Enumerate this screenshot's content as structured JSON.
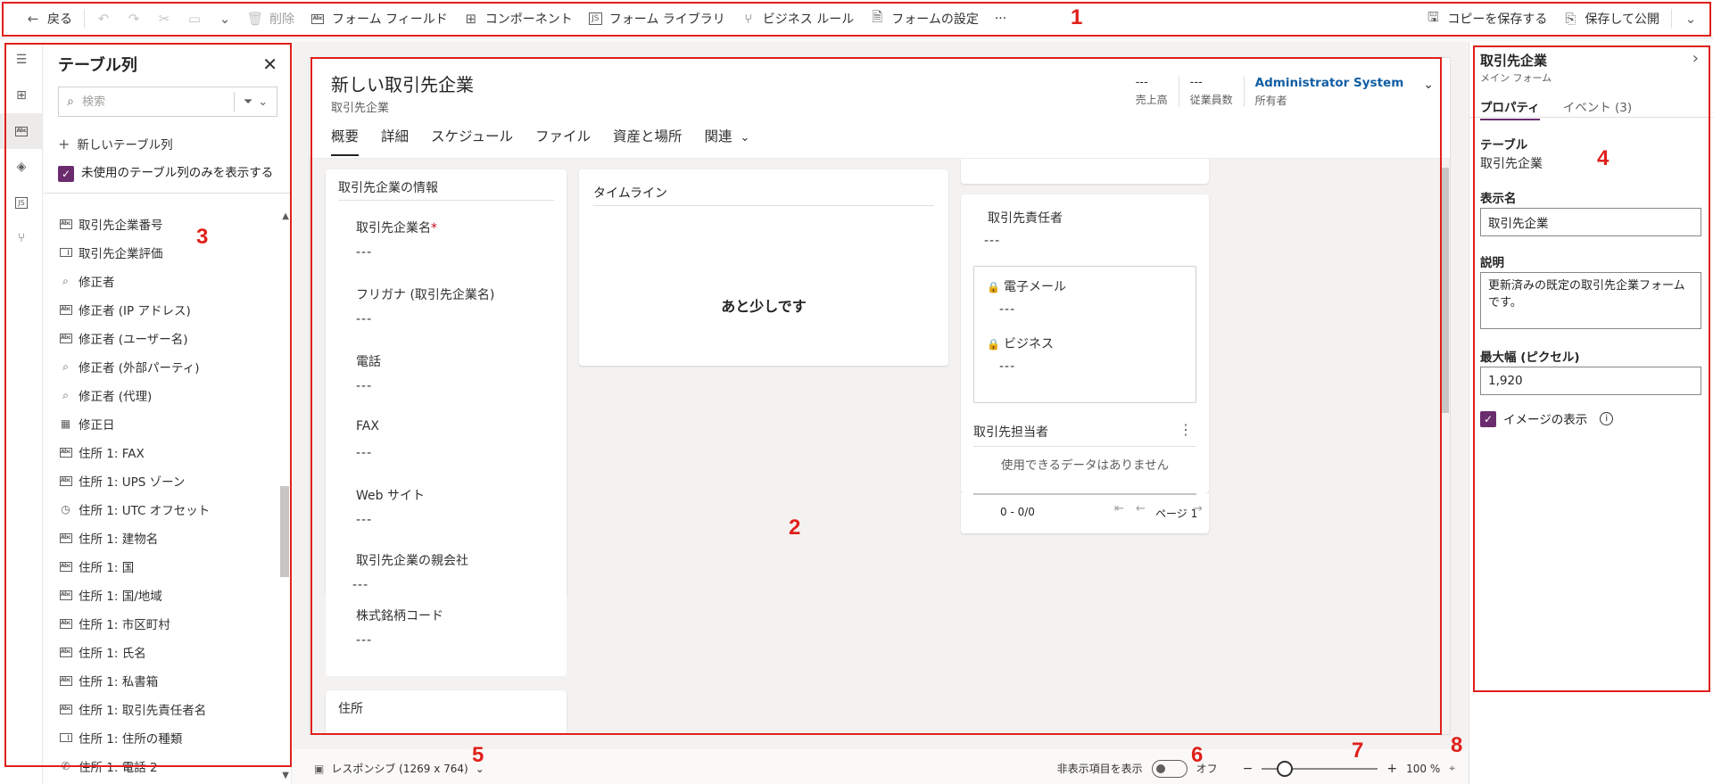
{
  "toolbar": {
    "back": "戻る",
    "delete": "削除",
    "form_field": "フォーム フィールド",
    "component": "コンポーネント",
    "form_library": "フォーム ライブラリ",
    "business_rule": "ビジネス ルール",
    "form_settings": "フォームの設定",
    "more": "···",
    "save_copy": "コピーを保存する",
    "save_publish": "保存して公開"
  },
  "columns_panel": {
    "title": "テーブル列",
    "search_placeholder": "検索",
    "new_column": "新しいテーブル列",
    "unused_only": "未使用のテーブル列のみを表示する",
    "items": [
      {
        "label": "取引先企業番号",
        "icon": "text-field-icon"
      },
      {
        "label": "取引先企業評価",
        "icon": "option-set-icon"
      },
      {
        "label": "修正者",
        "icon": "lookup-icon"
      },
      {
        "label": "修正者 (IP アドレス)",
        "icon": "text-field-icon"
      },
      {
        "label": "修正者 (ユーザー名)",
        "icon": "text-field-icon"
      },
      {
        "label": "修正者 (外部パーティ)",
        "icon": "lookup-icon"
      },
      {
        "label": "修正者 (代理)",
        "icon": "lookup-icon"
      },
      {
        "label": "修正日",
        "icon": "calendar-icon"
      },
      {
        "label": "住所 1: FAX",
        "icon": "text-field-icon"
      },
      {
        "label": "住所 1: UPS ゾーン",
        "icon": "text-field-icon"
      },
      {
        "label": "住所 1: UTC オフセット",
        "icon": "timezone-icon"
      },
      {
        "label": "住所 1: 建物名",
        "icon": "text-field-icon"
      },
      {
        "label": "住所 1: 国",
        "icon": "text-field-icon"
      },
      {
        "label": "住所 1: 国/地域",
        "icon": "text-field-icon"
      },
      {
        "label": "住所 1: 市区町村",
        "icon": "text-field-icon"
      },
      {
        "label": "住所 1: 氏名",
        "icon": "text-field-icon"
      },
      {
        "label": "住所 1: 私書箱",
        "icon": "text-field-icon"
      },
      {
        "label": "住所 1: 取引先責任者名",
        "icon": "text-field-icon"
      },
      {
        "label": "住所 1: 住所の種類",
        "icon": "option-set-icon"
      },
      {
        "label": "住所 1: 電話 2",
        "icon": "phone-icon"
      }
    ]
  },
  "form": {
    "title": "新しい取引先企業",
    "entity": "取引先企業",
    "header_fields": [
      {
        "value": "---",
        "label": "売上高"
      },
      {
        "value": "---",
        "label": "従業員数"
      }
    ],
    "owner": {
      "value": "Administrator System",
      "label": "所有者"
    },
    "tabs": [
      "概要",
      "詳細",
      "スケジュール",
      "ファイル",
      "資産と場所",
      "関連"
    ],
    "info_section": {
      "title": "取引先企業の情報",
      "fields": [
        {
          "label": "取引先企業名",
          "value": "---",
          "required": "*"
        },
        {
          "label": "フリガナ (取引先企業名)",
          "value": "---"
        },
        {
          "label": "電話",
          "value": "---"
        },
        {
          "label": "FAX",
          "value": "---"
        },
        {
          "label": "Web サイト",
          "value": "---"
        },
        {
          "label": "取引先企業の親会社",
          "value": "---"
        },
        {
          "label": "株式銘柄コード",
          "value": "---"
        }
      ]
    },
    "address_section": "住所",
    "timeline": {
      "title": "タイムライン",
      "message": "あと少しです"
    },
    "contact": {
      "primary_label": "取引先責任者",
      "primary_value": "---",
      "email_label": "電子メール",
      "email_value": "---",
      "business_label": "ビジネス",
      "business_value": "---"
    },
    "contacts_grid": {
      "title": "取引先担当者",
      "empty": "使用できるデータはありません",
      "range": "0 - 0/0",
      "page": "ページ 1"
    }
  },
  "bottom_bar": {
    "layout": "レスポンシブ (1269 x 764)",
    "show_hidden": "非表示項目を表示",
    "toggle_state": "オフ",
    "zoom": "100 %",
    "zoom_level": 0.2
  },
  "properties": {
    "title": "取引先企業",
    "subtitle": "メイン フォーム",
    "tab_properties": "プロパティ",
    "tab_events": "イベント (3)",
    "table_label": "テーブル",
    "table_value": "取引先企業",
    "display_name_label": "表示名",
    "display_name_value": "取引先企業",
    "description_label": "説明",
    "description_value": "更新済みの既定の取引先企業フォームです。",
    "max_width_label": "最大幅 (ピクセル)",
    "max_width_value": "1,920",
    "show_image_label": "イメージの表示"
  },
  "annotations": [
    "1",
    "2",
    "3",
    "4",
    "5",
    "6",
    "7",
    "8"
  ],
  "colors": {
    "accent": "#6b2c6e",
    "annotation": "#e0201b",
    "owner_link": "#115ea3"
  }
}
